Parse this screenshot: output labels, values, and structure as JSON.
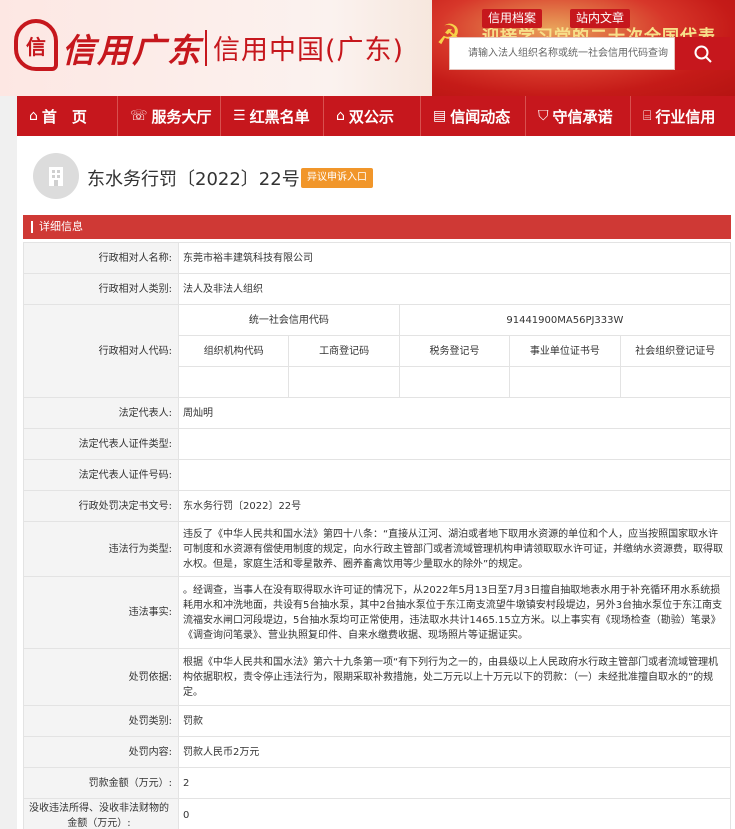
{
  "header": {
    "logo_cal": "信用广东",
    "logo_title": "信用中国(广东)",
    "banner_text": "迎接学习党的二十次全国代表",
    "links": [
      "信用档案",
      "站内文章"
    ],
    "search_placeholder": "请输入法人组织名称或统一社会信用代码查询"
  },
  "nav": [
    {
      "icon": "home-icon",
      "label": "首　页"
    },
    {
      "icon": "service-hall-icon",
      "label": "服务大厅"
    },
    {
      "icon": "list-icon",
      "label": "红黑名单"
    },
    {
      "icon": "publicity-icon",
      "label": "双公示"
    },
    {
      "icon": "news-icon",
      "label": "信闻动态"
    },
    {
      "icon": "shield-icon",
      "label": "守信承诺"
    },
    {
      "icon": "bank-icon",
      "label": "行业信用"
    }
  ],
  "doc": {
    "title": "东水务行罚〔2022〕22号",
    "objection_label": "异议申诉入口"
  },
  "section_label": "详细信息",
  "detail": {
    "name_label": "行政相对人名称:",
    "name_value": "东莞市裕丰建筑科技有限公司",
    "category_label": "行政相对人类别:",
    "category_value": "法人及非法人组织",
    "code_label": "行政相对人代码:",
    "credit_code_header": "统一社会信用代码",
    "credit_code_value": "91441900MA56PJ333W",
    "sub_headers": [
      "组织机构代码",
      "工商登记码",
      "税务登记号",
      "事业单位证书号",
      "社会组织登记证号"
    ],
    "rep_label": "法定代表人:",
    "rep_value": "周灿明",
    "rep_id_type_label": "法定代表人证件类型:",
    "rep_id_no_label": "法定代表人证件号码:",
    "decision_label": "行政处罚决定书文号:",
    "decision_value": "东水务行罚〔2022〕22号",
    "violation_type_label": "违法行为类型:",
    "violation_type_value": "违反了《中华人民共和国水法》第四十八条：“直接从江河、湖泊或者地下取用水资源的单位和个人，应当按照国家取水许可制度和水资源有偿使用制度的规定，向水行政主管部门或者流域管理机构申请领取取水许可证，并缴纳水资源费，取得取水权。但是，家庭生活和零星散养、圈养畜禽饮用等少量取水的除外”的规定。",
    "facts_label": "违法事实:",
    "facts_value": "。经调查，当事人在没有取得取水许可证的情况下，从2022年5月13日至7月3日擅自抽取地表水用于补充循环用水系统损耗用水和冲洗地面，共设有5台抽水泵，其中2台抽水泵位于东江南支流望牛墩镇安村段堤边，另外3台抽水泵位于东江南支流福安水闸口河段堤边，5台抽水泵均可正常使用，违法取水共计1465.15立方米。以上事实有《现场检查（勘验）笔录》《调查询问笔录》、营业执照复印件、自来水缴费收据、现场照片等证据证实。",
    "basis_label": "处罚依据:",
    "basis_value": "根据《中华人民共和国水法》第六十九条第一项“有下列行为之一的，由县级以上人民政府水行政主管部门或者流域管理机构依据职权，责令停止违法行为，限期采取补救措施，处二万元以上十万元以下的罚款：（一）未经批准擅自取水的”的规定。",
    "penalty_type_label": "处罚类别:",
    "penalty_type_value": "罚款",
    "penalty_content_label": "处罚内容:",
    "penalty_content_value": "罚款人民币2万元",
    "fine_label": "罚款金额（万元）:",
    "fine_value": "2",
    "confiscate_label": "没收违法所得、没收非法财物的金额（万元）:",
    "confiscate_value": "0"
  }
}
